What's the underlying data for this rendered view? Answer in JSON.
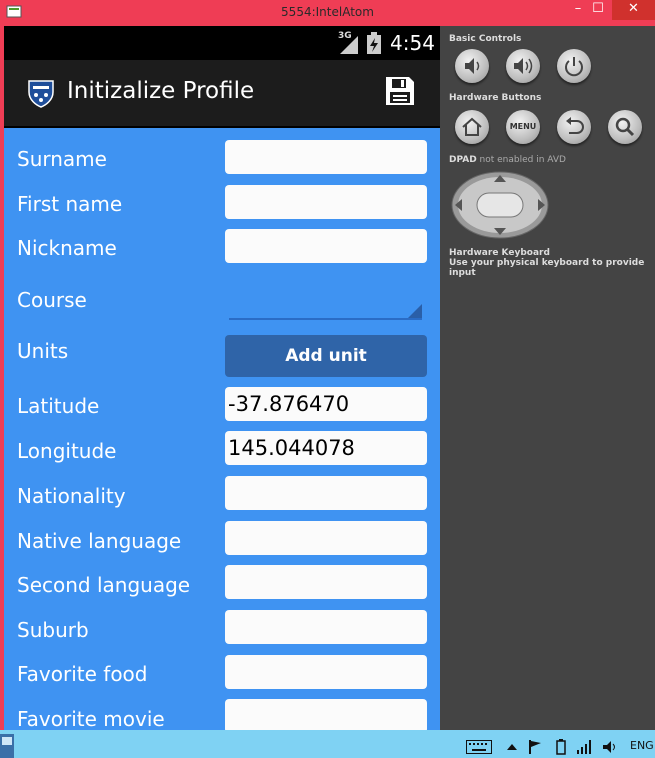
{
  "window": {
    "title": "5554:IntelAtom",
    "minimize": "–",
    "maximize": "☐",
    "close": "✕"
  },
  "statusbar": {
    "network": "3G",
    "time": "4:54"
  },
  "actionbar": {
    "title": "Initizalize Profile"
  },
  "form": {
    "surname_label": "Surname",
    "surname_value": "",
    "first_name_label": "First name",
    "first_name_value": "",
    "nickname_label": "Nickname",
    "nickname_value": "",
    "course_label": "Course",
    "units_label": "Units",
    "add_unit_button": "Add unit",
    "latitude_label": "Latitude",
    "latitude_value": "-37.876470",
    "longitude_label": "Longitude",
    "longitude_value": "145.044078",
    "nationality_label": "Nationality",
    "nationality_value": "",
    "native_language_label": "Native language",
    "native_language_value": "",
    "second_language_label": "Second language",
    "second_language_value": "",
    "suburb_label": "Suburb",
    "suburb_value": "",
    "favorite_food_label": "Favorite food",
    "favorite_food_value": "",
    "favorite_movie_label": "Favorite movie",
    "favorite_movie_value": ""
  },
  "panel": {
    "basic_controls": "Basic Controls",
    "hardware_buttons": "Hardware Buttons",
    "menu_button": "MENU",
    "dpad_bold": "DPAD",
    "dpad_rest": " not enabled in AVD",
    "keyboard_title": "Hardware Keyboard",
    "keyboard_desc": "Use your physical keyboard to provide input"
  },
  "taskbar": {
    "language": "ENG"
  },
  "colors": {
    "screen_bg": "#3f93f2",
    "button": "#2f64a8",
    "frame": "#ef3d55",
    "panel": "#444444"
  }
}
